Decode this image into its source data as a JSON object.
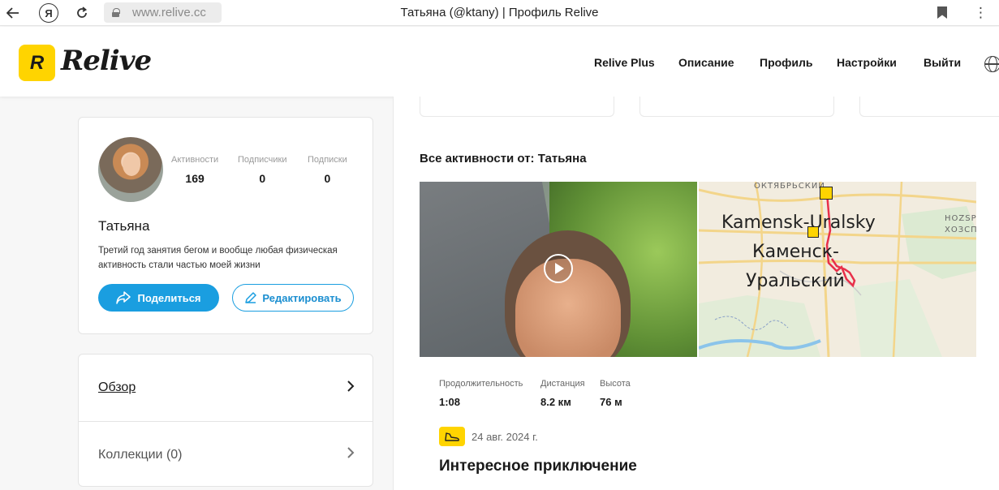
{
  "browser": {
    "url": "www.relive.cc",
    "title": "Татьяна (@ktany) | Профиль Relive",
    "yandex_label": "Я"
  },
  "header": {
    "logo_text": "Relive",
    "logo_mark": "R",
    "nav": [
      {
        "label": "Relive Plus"
      },
      {
        "label": "Описание"
      },
      {
        "label": "Профиль"
      },
      {
        "label": "Настройки"
      },
      {
        "label": "Выйти"
      }
    ]
  },
  "profile": {
    "name": "Татьяна",
    "bio": "Третий год занятия бегом и вообще любая физическая активность стали частью моей жизни",
    "stats": [
      {
        "label": "Активности",
        "value": "169"
      },
      {
        "label": "Подписчики",
        "value": "0"
      },
      {
        "label": "Подписки",
        "value": "0"
      }
    ],
    "share_label": "Поделиться",
    "edit_label": "Редактировать"
  },
  "menu": {
    "overview_label": "Обзор",
    "collections_label": "Коллекции",
    "collections_count": "(0)"
  },
  "activities": {
    "heading": "Все активности от: Татьяна",
    "items": [
      {
        "metrics": [
          {
            "label": "Продолжительность",
            "value": "1:08"
          },
          {
            "label": "Дистанция",
            "value": "8.2 км"
          },
          {
            "label": "Высота",
            "value": "76 м"
          }
        ],
        "date": "24 авг. 2024 г.",
        "title": "Интересное приключение",
        "sport_icon": "running-shoe-icon",
        "map": {
          "label_latin": "Kamensk-Uralsky",
          "label_cyr_1": "Каменск-",
          "label_cyr_2": "Уральский",
          "district": "ОКТЯБРЬСКИЙ",
          "farm_1": "HOZSPO",
          "farm_2": "ХОЗСПО"
        }
      }
    ]
  },
  "colors": {
    "brand_yellow": "#ffd400",
    "accent_blue": "#1a9ee0",
    "route_red": "#e8304a"
  }
}
